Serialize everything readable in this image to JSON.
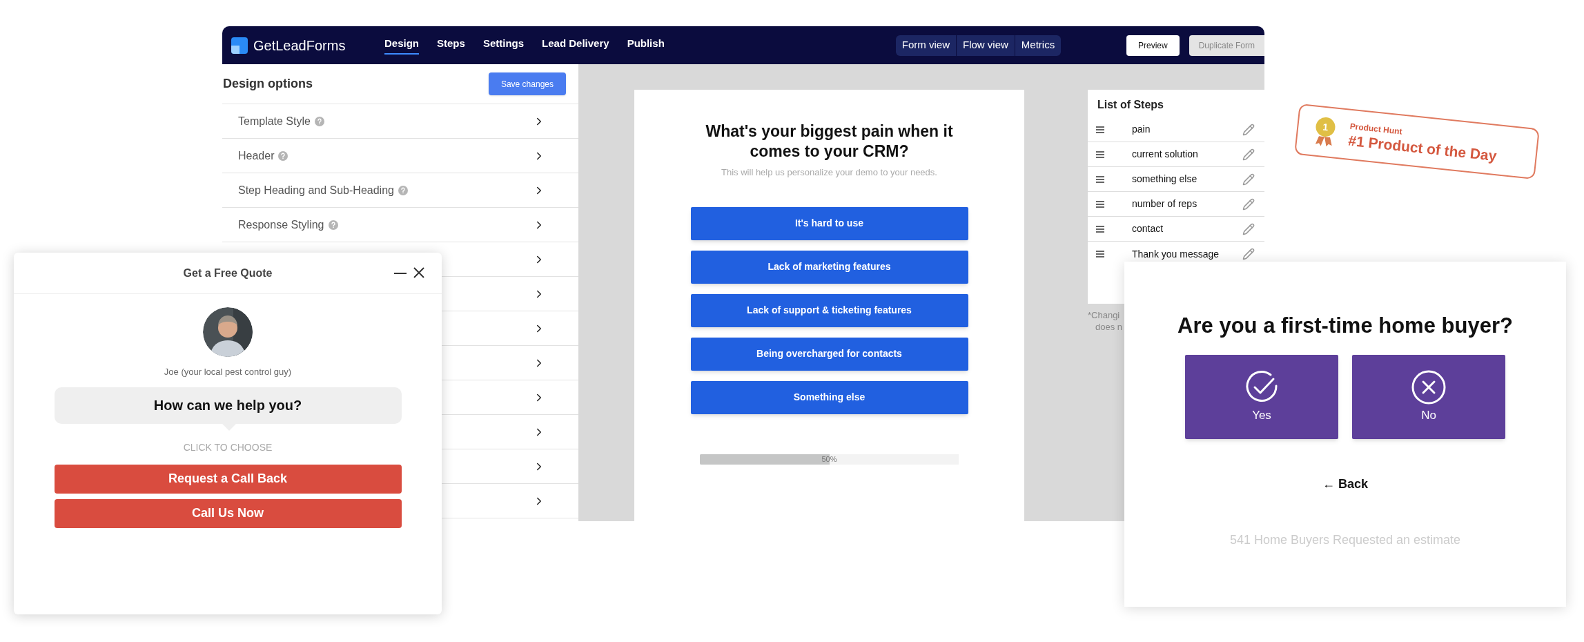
{
  "app": {
    "logo": "GetLeadForms",
    "nav_tabs": [
      {
        "label": "Design",
        "selected": true
      },
      {
        "label": "Steps",
        "selected": false
      },
      {
        "label": "Settings",
        "selected": false
      },
      {
        "label": "Lead Delivery",
        "selected": false
      },
      {
        "label": "Publish",
        "selected": false
      }
    ],
    "view_tabs": [
      {
        "label": "Form view"
      },
      {
        "label": "Flow view"
      },
      {
        "label": "Metrics"
      }
    ],
    "buttons": [
      {
        "label": "Preview",
        "disabled": false
      },
      {
        "label": "Duplicate Form",
        "disabled": true
      }
    ]
  },
  "design_options": {
    "title": "Design options",
    "save_button": "Save changes",
    "items": [
      {
        "label": "Template Style",
        "help": true
      },
      {
        "label": "Header",
        "help": true
      },
      {
        "label": "Step Heading and Sub-Heading",
        "help": true
      },
      {
        "label": "Response Styling",
        "help": true
      }
    ]
  },
  "form_preview": {
    "question": "What's your biggest pain when it comes to your CRM?",
    "subtitle": "This will help us personalize your demo to your needs.",
    "answers": [
      "It's hard to use",
      "Lack of marketing features",
      "Lack of support & ticketing features",
      "Being overcharged for contacts",
      "Something else"
    ],
    "progress": {
      "level": 0.5,
      "reading": "50%"
    }
  },
  "steps_panel": {
    "title": "List of Steps",
    "steps": [
      "pain",
      "current solution",
      "something else",
      "number of reps",
      "contact",
      "Thank you message"
    ],
    "note_lines": [
      "*Changi",
      "does n"
    ]
  },
  "badge": {
    "medal_number": "1",
    "source": "Product Hunt",
    "title": "#1 Product of the Day"
  },
  "chat_widget": {
    "title": "Get a Free Quote",
    "agent": "Joe (your local pest control guy)",
    "question": "How can we help you?",
    "hint": "CLICK TO CHOOSE",
    "buttons": [
      "Request a Call Back",
      "Call Us Now"
    ]
  },
  "home_buyer_form": {
    "question": "Are you a first-time home buyer?",
    "options": [
      {
        "label": "Yes",
        "kind": "check"
      },
      {
        "label": "No",
        "kind": "cross"
      }
    ],
    "back": "← Back",
    "footer": "541 Home Buyers Requested an estimate"
  }
}
